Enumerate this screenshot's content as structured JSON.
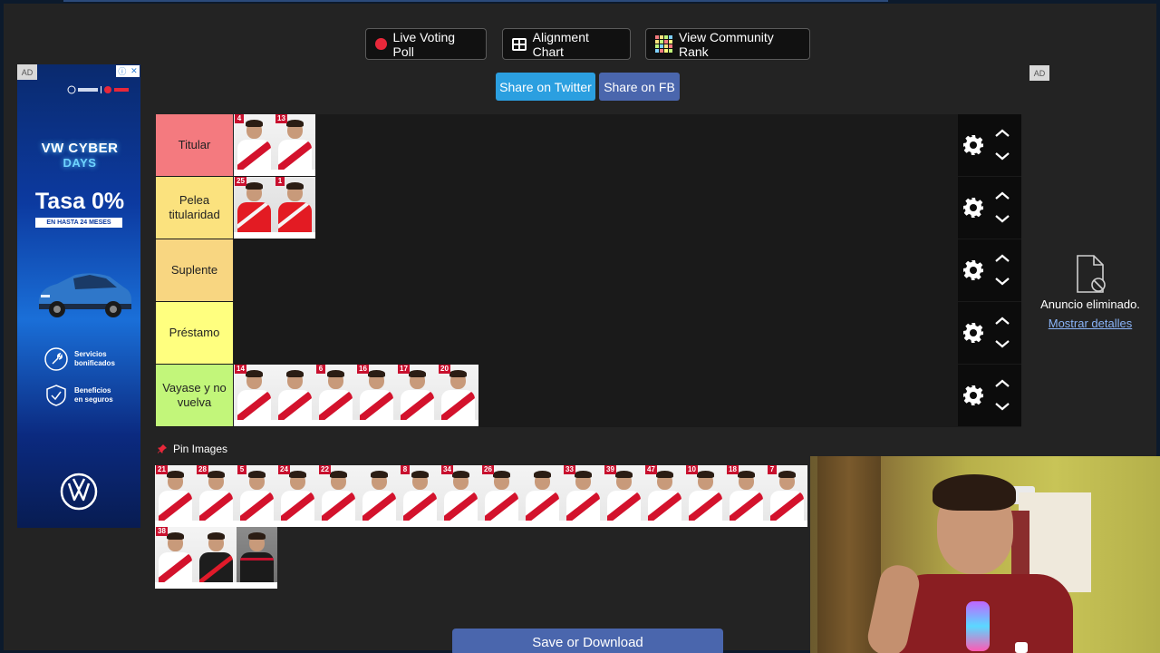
{
  "toolbar": {
    "live_poll_label": "Live Voting Poll",
    "alignment_label": "Alignment Chart",
    "community_label": "View Community Rank"
  },
  "share": {
    "twitter_label": "Share on Twitter",
    "fb_label": "Share on FB"
  },
  "colors": {
    "twitter": "#2b9fe0",
    "facebook": "#4a66ad",
    "tier_titular": "#f47a7f",
    "tier_pelea": "#fbe27e",
    "tier_suplente": "#f8d681",
    "tier_prestamo": "#ffff7f",
    "tier_vayase": "#c2f67a"
  },
  "tiers": [
    {
      "label": "Titular",
      "color": "#f47a7f",
      "cards": [
        {
          "num": "4",
          "type": "home"
        },
        {
          "num": "13",
          "type": "home"
        }
      ]
    },
    {
      "label": "Pelea titularidad",
      "color": "#fbe27e",
      "cards": [
        {
          "num": "25",
          "type": "red"
        },
        {
          "num": "1",
          "type": "red"
        }
      ]
    },
    {
      "label": "Suplente",
      "color": "#f8d681",
      "cards": []
    },
    {
      "label": "Préstamo",
      "color": "#ffff7f",
      "cards": []
    },
    {
      "label": "Vayase y no vuelva",
      "color": "#c2f67a",
      "cards": [
        {
          "num": "14",
          "type": "home"
        },
        {
          "num": "",
          "type": "home"
        },
        {
          "num": "6",
          "type": "home"
        },
        {
          "num": "16",
          "type": "home"
        },
        {
          "num": "17",
          "type": "home"
        },
        {
          "num": "20",
          "type": "home"
        }
      ]
    }
  ],
  "pin": {
    "title": "Pin Images",
    "cards": [
      {
        "num": "21",
        "type": "home"
      },
      {
        "num": "28",
        "type": "home"
      },
      {
        "num": "5",
        "type": "home"
      },
      {
        "num": "24",
        "type": "home"
      },
      {
        "num": "22",
        "type": "home"
      },
      {
        "num": "",
        "type": "home"
      },
      {
        "num": "8",
        "type": "home"
      },
      {
        "num": "34",
        "type": "home"
      },
      {
        "num": "26",
        "type": "home"
      },
      {
        "num": "",
        "type": "home"
      },
      {
        "num": "33",
        "type": "home"
      },
      {
        "num": "39",
        "type": "home"
      },
      {
        "num": "47",
        "type": "home"
      },
      {
        "num": "10",
        "type": "home"
      },
      {
        "num": "18",
        "type": "home"
      },
      {
        "num": "7",
        "type": "home"
      },
      {
        "num": "38",
        "type": "home"
      },
      {
        "num": "",
        "type": "dark"
      },
      {
        "num": "",
        "type": "coach"
      }
    ]
  },
  "save_label": "Save or Download",
  "ad_left": {
    "badge": "AD",
    "headline": "VW CYBER",
    "headline2": "DAYS",
    "rate": "Tasa 0%",
    "rate_sub": "EN HASTA 24 MESES",
    "perk1": "Servicios bonificados",
    "perk2": "Beneficios en seguros"
  },
  "ad_right": {
    "badge": "AD",
    "message": "Anuncio eliminado.",
    "link": "Mostrar detalles"
  }
}
